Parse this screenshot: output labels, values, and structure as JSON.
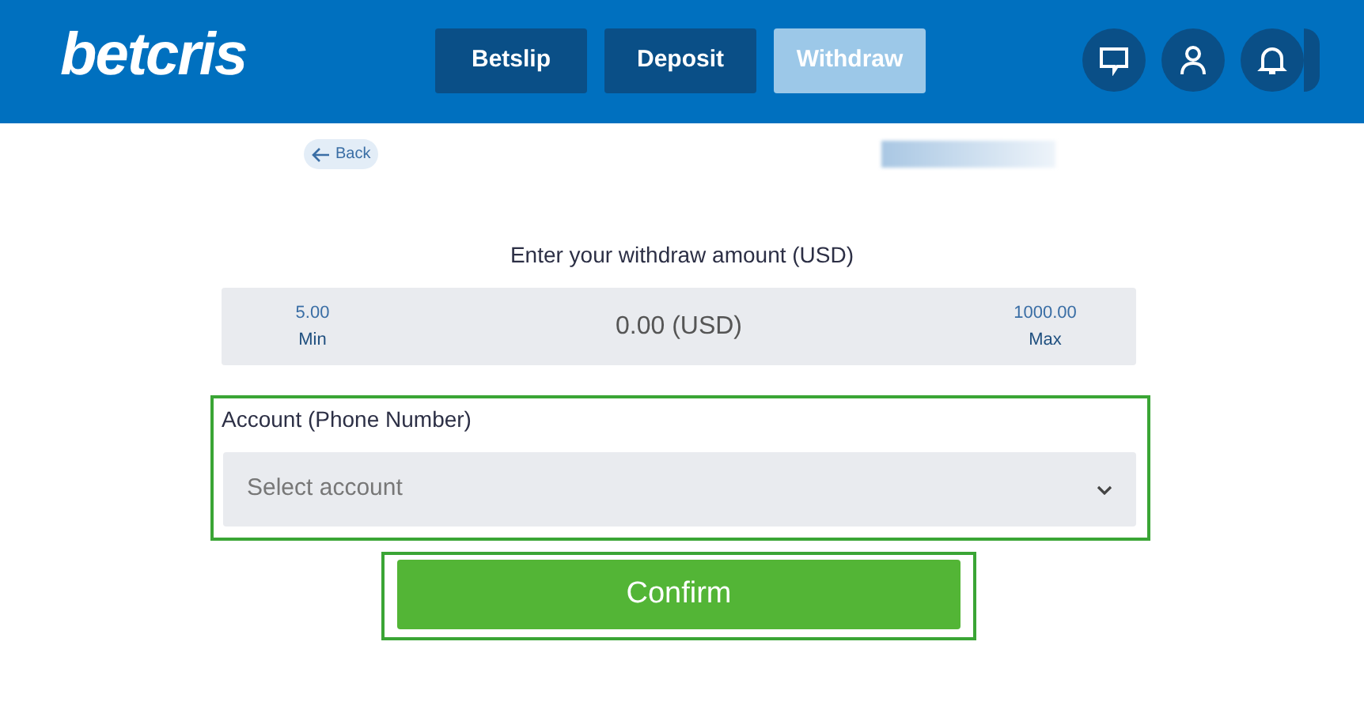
{
  "header": {
    "logo": "betcris",
    "tabs": [
      {
        "label": "Betslip",
        "selected": false
      },
      {
        "label": "Deposit",
        "selected": false
      },
      {
        "label": "Withdraw",
        "selected": true
      }
    ]
  },
  "back_link": "Back",
  "form": {
    "title": "Enter your withdraw amount (USD)",
    "min": {
      "value": "5.00",
      "label": "Min"
    },
    "amount": "0.00 (USD)",
    "max": {
      "value": "1000.00",
      "label": "Max"
    },
    "account_label": "Account (Phone Number)",
    "account_select": {
      "placeholder": "Select account"
    },
    "confirm": "Confirm"
  }
}
